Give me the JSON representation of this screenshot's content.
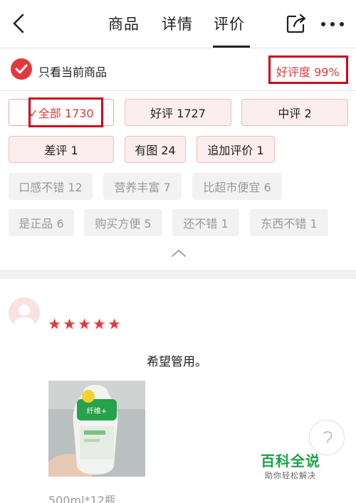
{
  "header": {
    "tabs": [
      {
        "label": "商品",
        "active": false
      },
      {
        "label": "详情",
        "active": false
      },
      {
        "label": "评价",
        "active": true
      }
    ]
  },
  "filter": {
    "only_current_label": "只看当前商品",
    "good_rate": "好评度 99%"
  },
  "chips": [
    {
      "label": "✓全部 1730",
      "style": "active"
    },
    {
      "label": "好评 1727",
      "style": "pink"
    },
    {
      "label": "中评 2",
      "style": "pink"
    },
    {
      "label": "差评 1",
      "style": "pink"
    },
    {
      "label": "有图 24",
      "style": "pink"
    },
    {
      "label": "追加评价 1",
      "style": "pink"
    },
    {
      "label": "口感不错 12",
      "style": "gray"
    },
    {
      "label": "营养丰富 7",
      "style": "gray"
    },
    {
      "label": "比超市便宜 6",
      "style": "gray"
    },
    {
      "label": "是正品 6",
      "style": "gray"
    },
    {
      "label": "购买方便 5",
      "style": "gray"
    },
    {
      "label": "还不错 1",
      "style": "gray"
    },
    {
      "label": "东西不错 1",
      "style": "gray"
    }
  ],
  "review": {
    "stars": 5,
    "text": "希望管用。",
    "spec": "500ml*12瓶"
  },
  "watermark": {
    "title": "百科全说",
    "subtitle": "助你轻松解决"
  },
  "colors": {
    "accent": "#e4393c",
    "frame": "#d0021b",
    "watermark": "#1aa34a"
  }
}
